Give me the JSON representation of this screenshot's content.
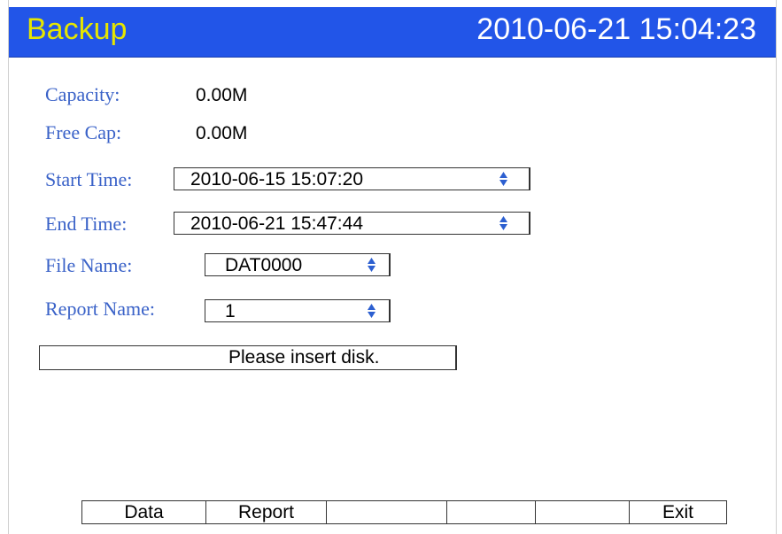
{
  "header": {
    "title": "Backup",
    "clock": "2010-06-21 15:04:23"
  },
  "info": {
    "capacity_label": "Capacity:",
    "capacity_value": "0.00M",
    "free_label": "Free Cap:",
    "free_value": "0.00M"
  },
  "form": {
    "start_label": "Start Time:",
    "start_value": "2010-06-15 15:07:20",
    "end_label": "End Time:",
    "end_value": "2010-06-21 15:47:44",
    "file_label": "File Name:",
    "file_value": "DAT0000",
    "report_label": "Report Name:",
    "report_value": "1"
  },
  "status": {
    "message": "Please insert disk."
  },
  "softkeys": [
    "Data",
    "Report",
    "",
    "",
    "",
    "Exit"
  ],
  "colors": {
    "titlebar": "#2255e8",
    "title": "#e6e600",
    "label": "#3a62c8",
    "spinner": "#2c5fd0"
  },
  "icons": {
    "spinner": "up-down-spinner-icon"
  }
}
